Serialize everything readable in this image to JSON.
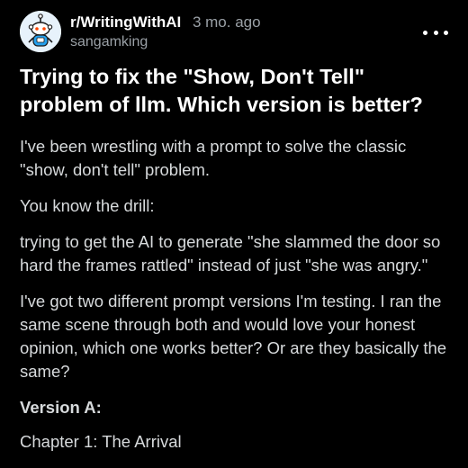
{
  "post": {
    "subreddit": "r/WritingWithAI",
    "age": "3 mo. ago",
    "author": "sangamking",
    "title": "Trying to fix the \"Show, Don't Tell\" problem of llm. Which version is better?",
    "paragraphs": [
      "I've been wrestling with a prompt to solve the classic \"show, don't tell\" problem.",
      "You know the drill:",
      "trying to get the AI to generate \"she slammed the door so hard the frames rattled\" instead of just \"she was angry.\"",
      "I've got two different prompt versions I'm testing. I ran the same scene through both and would love your honest opinion, which one works better? Or are they basically the same?"
    ],
    "version_heading": "Version A:",
    "chapter_line": "Chapter 1: The Arrival"
  },
  "icons": {
    "avatar": "reddit-snoo-avatar-icon",
    "more": "more-options-icon"
  },
  "colors": {
    "background": "#000000",
    "title": "#ffffff",
    "body_text": "#d7dadc",
    "meta_text": "#9aa0a6",
    "avatar_bg": "#e7f2fb"
  }
}
